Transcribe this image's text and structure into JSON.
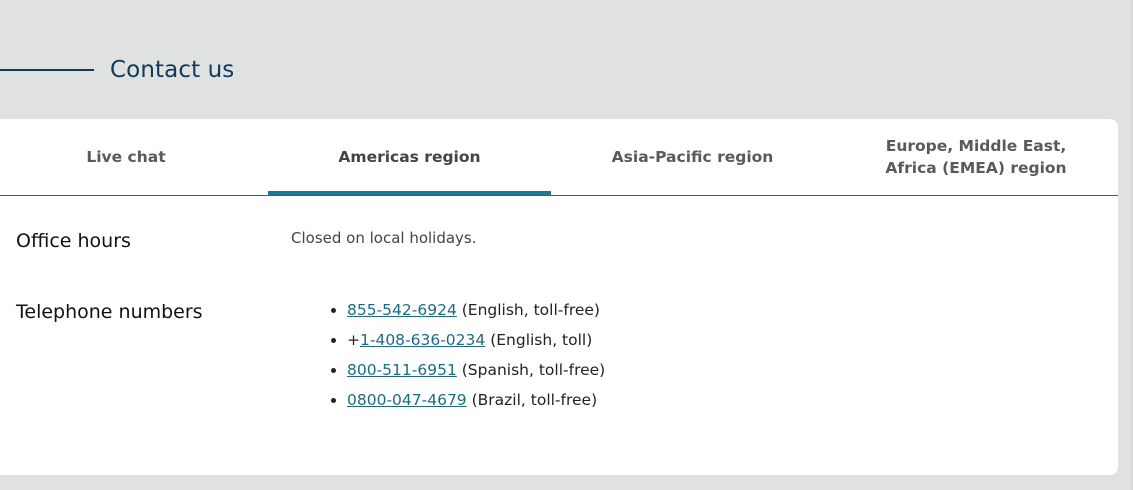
{
  "section": {
    "title": "Contact us"
  },
  "tabs": [
    {
      "label": "Live chat"
    },
    {
      "label": "Americas region"
    },
    {
      "label": "Asia-Pacific region"
    },
    {
      "label": "Europe, Middle East, Africa (EMEA) region"
    }
  ],
  "active_tab": "Americas region",
  "office_hours": {
    "label": "Office hours",
    "text": "Closed on local holidays."
  },
  "telephone": {
    "label": "Telephone numbers",
    "numbers": [
      {
        "prefix": "",
        "number": "855-542-6924",
        "note": " (English, toll-free)"
      },
      {
        "prefix": "+",
        "number": "1-408-636-0234",
        "note": " (English, toll)"
      },
      {
        "prefix": "",
        "number": "800-511-6951",
        "note": " (Spanish, toll-free)"
      },
      {
        "prefix": "",
        "number": "0800-047-4679",
        "note": " (Brazil, toll-free)"
      }
    ]
  },
  "colors": {
    "background": "#e0e1e1",
    "heading": "#0e3a5f",
    "accent": "#1a7a93",
    "link": "#1d6b86"
  }
}
